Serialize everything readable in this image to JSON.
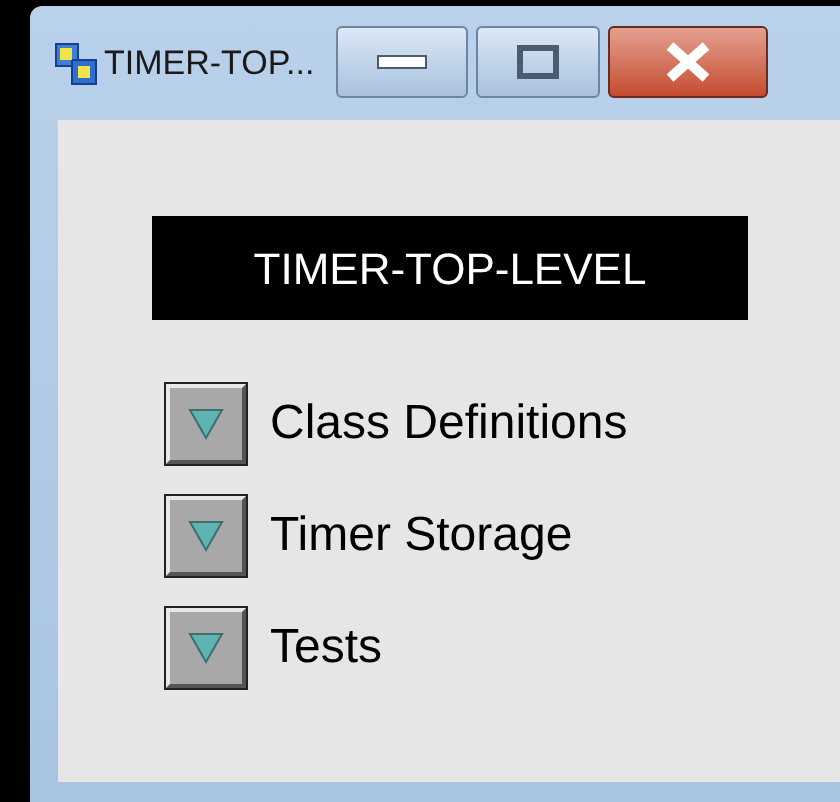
{
  "window": {
    "title": "TIMER-TOP..."
  },
  "heading": "TIMER-TOP-LEVEL",
  "items": [
    {
      "label": "Class Definitions",
      "expanded": false
    },
    {
      "label": "Timer Storage",
      "expanded": false
    },
    {
      "label": "Tests",
      "expanded": false
    }
  ]
}
